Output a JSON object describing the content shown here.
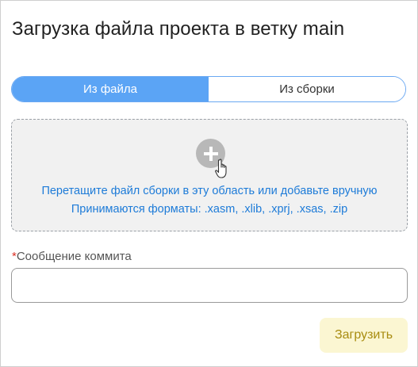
{
  "dialog": {
    "title": "Загрузка файла проекта в ветку main"
  },
  "source_tabs": {
    "from_file": "Из файла",
    "from_build": "Из сборки",
    "active": "from_file"
  },
  "dropzone": {
    "add_icon": "plus-icon",
    "cursor_icon": "hand-pointer-icon",
    "line1": "Перетащите файл сборки в эту область или добавьте вручную",
    "line2": "Принимаются форматы: .xasm, .xlib, .xprj, .xsas, .zip"
  },
  "commit": {
    "required_mark": "*",
    "label": "Сообщение коммита",
    "value": "",
    "placeholder": ""
  },
  "actions": {
    "upload_label": "Загрузить"
  },
  "colors": {
    "accent": "#5ba4f5",
    "link": "#1d7bd8",
    "required": "#d93025",
    "upload_bg": "#fbf6d2",
    "upload_text": "#a88c10"
  }
}
